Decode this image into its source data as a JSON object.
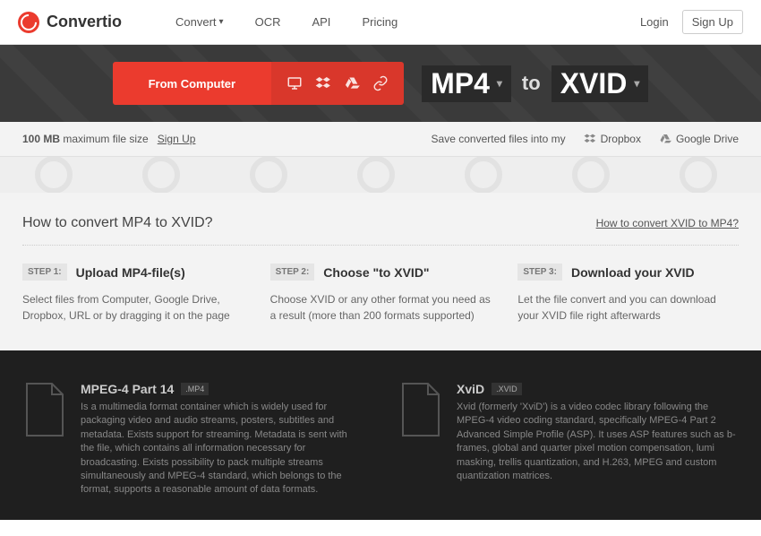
{
  "brand": "Convertio",
  "nav": {
    "convert": "Convert",
    "ocr": "OCR",
    "api": "API",
    "pricing": "Pricing"
  },
  "auth": {
    "login": "Login",
    "signup": "Sign Up"
  },
  "hero": {
    "from_computer": "From Computer",
    "format_from": "MP4",
    "to": "to",
    "format_to": "XVID"
  },
  "midbar": {
    "max_size_bold": "100 MB",
    "max_size_rest": " maximum file size",
    "signup_link": "Sign Up",
    "save_into": "Save converted files into my",
    "dropbox": "Dropbox",
    "google_drive": "Google Drive"
  },
  "howto": {
    "title": "How to convert MP4 to XVID?",
    "link": "How to convert XVID to MP4?",
    "steps": [
      {
        "label": "STEP 1:",
        "title": "Upload MP4-file(s)",
        "desc": "Select files from Computer, Google Drive, Dropbox, URL or by dragging it on the page"
      },
      {
        "label": "STEP 2:",
        "title": "Choose \"to XVID\"",
        "desc": "Choose XVID or any other format you need as a result (more than 200 formats supported)"
      },
      {
        "label": "STEP 3:",
        "title": "Download your XVID",
        "desc": "Let the file convert and you can download your XVID file right afterwards"
      }
    ]
  },
  "formats": [
    {
      "name": "MPEG-4 Part 14",
      "ext": ".MP4",
      "desc": "Is a multimedia format container which is widely used for packaging video and audio streams, posters, subtitles and metadata. Exists support for streaming. Metadata is sent with the file, which contains all information necessary for broadcasting. Exists possibility to pack multiple streams simultaneously and MPEG-4 standard, which belongs to the format, supports a reasonable amount of data formats."
    },
    {
      "name": "XviD",
      "ext": ".XVID",
      "desc": "Xvid (formerly 'XviD') is a video codec library following the MPEG-4 video coding standard, specifically MPEG-4 Part 2 Advanced Simple Profile (ASP). It uses ASP features such as b-frames, global and quarter pixel motion compensation, lumi masking, trellis quantization, and H.263, MPEG and custom quantization matrices."
    }
  ]
}
